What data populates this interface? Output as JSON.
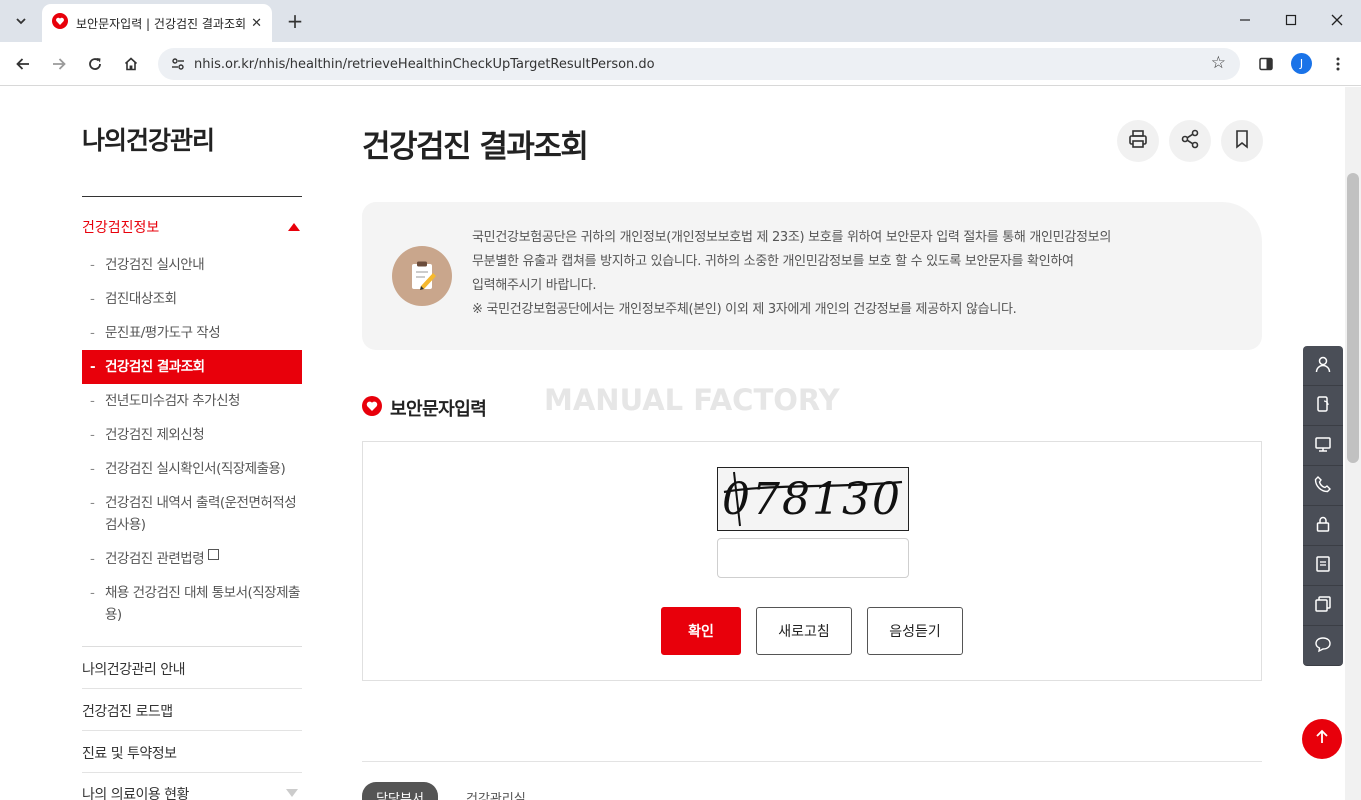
{
  "browser": {
    "tab_title": "보안문자입력 | 건강검진 결과조회",
    "url": "nhis.or.kr/nhis/healthin/retrieveHealthinCheckUpTargetResultPerson.do",
    "profile_initial": "J"
  },
  "sidebar": {
    "title": "나의건강관리",
    "section_title": "건강검진정보",
    "items": [
      {
        "label": "건강검진 실시안내"
      },
      {
        "label": "검진대상조회"
      },
      {
        "label": "문진표/평가도구 작성"
      },
      {
        "label": "건강검진 결과조회"
      },
      {
        "label": "전년도미수검자 추가신청"
      },
      {
        "label": "건강검진 제외신청"
      },
      {
        "label": "건강검진 실시확인서(직장제출용)"
      },
      {
        "label": "건강검진 내역서 출력(운전면허적성검사용)"
      },
      {
        "label": "건강검진 관련법령"
      },
      {
        "label": "채용 건강검진 대체 통보서(직장제출용)"
      }
    ],
    "menus": [
      {
        "label": "나의건강관리 안내"
      },
      {
        "label": "건강검진 로드맵"
      },
      {
        "label": "진료 및 투약정보"
      },
      {
        "label": "나의 의료이용 현황"
      }
    ]
  },
  "main": {
    "title": "건강검진 결과조회",
    "notice": {
      "line1": "국민건강보험공단은 귀하의 개인정보(개인정보보호법 제 23조) 보호를 위하여 보안문자 입력 절차를 통해 개인민감정보의",
      "line2": "무분별한 유출과 캡쳐를 방지하고 있습니다. 귀하의 소중한 개인민감정보를 보호 할 수 있도록 보안문자를 확인하여",
      "line3": "입력해주시기 바랍니다.",
      "line4": "※ 국민건강보험공단에서는 개인정보주체(본인) 이외 제 3자에게 개인의 건강정보를 제공하지 않습니다."
    },
    "watermark": "MANUAL FACTORY",
    "section_title": "보안문자입력",
    "captcha_text": "078130",
    "captcha_input_value": "",
    "buttons": {
      "confirm": "확인",
      "refresh": "새로고침",
      "audio": "음성듣기"
    },
    "bottom_tabs": [
      "담당부서",
      "건강관리실"
    ]
  },
  "colors": {
    "accent": "#e8000b",
    "quick_menu": "#4a4e57"
  }
}
